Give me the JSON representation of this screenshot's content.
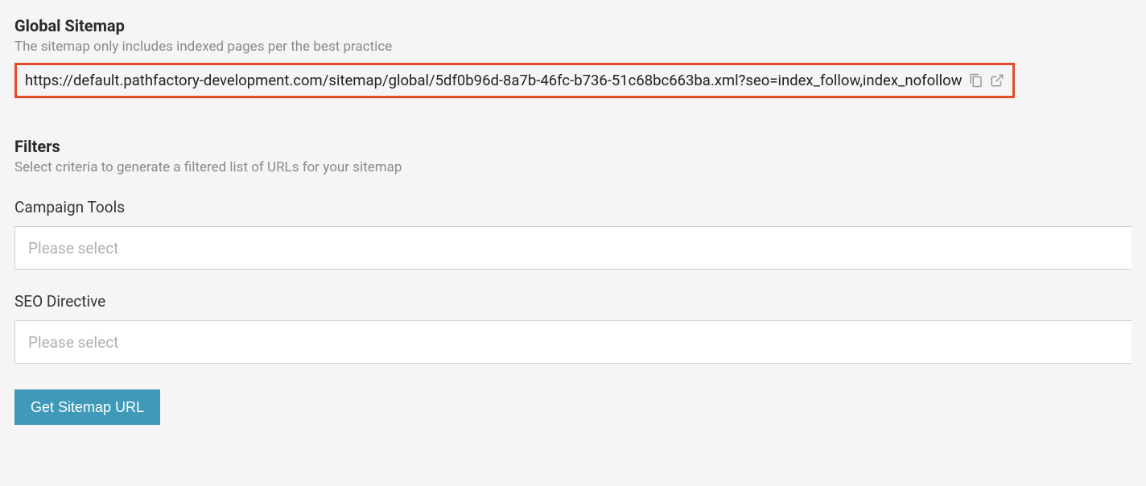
{
  "global_sitemap": {
    "title": "Global Sitemap",
    "subtitle": "The sitemap only includes indexed pages per the best practice",
    "url": "https://default.pathfactory-development.com/sitemap/global/5df0b96d-8a7b-46fc-b736-51c68bc663ba.xml?seo=index_follow,index_nofollow"
  },
  "filters": {
    "title": "Filters",
    "subtitle": "Select criteria to generate a filtered list of URLs for your sitemap",
    "campaign_tools": {
      "label": "Campaign Tools",
      "placeholder": "Please select"
    },
    "seo_directive": {
      "label": "SEO Directive",
      "placeholder": "Please select"
    },
    "button_label": "Get Sitemap URL"
  }
}
